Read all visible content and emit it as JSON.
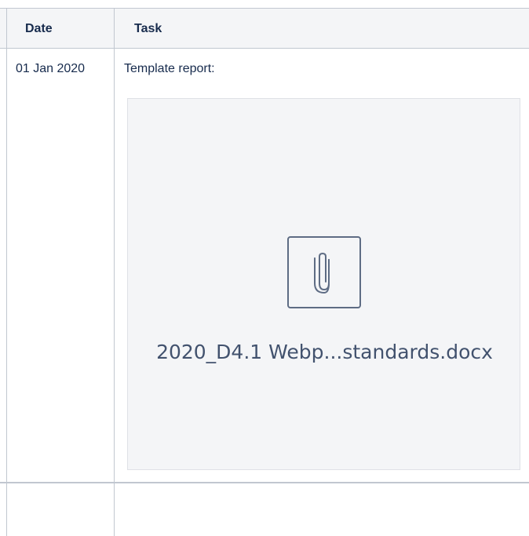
{
  "table": {
    "headers": {
      "date": "Date",
      "task": "Task"
    },
    "rows": [
      {
        "date": "01 Jan 2020",
        "task_label": "Template report:",
        "attachment": {
          "icon": "paperclip-icon",
          "file_name": "2020_D4.1 Webp...standards.docx"
        }
      }
    ]
  }
}
